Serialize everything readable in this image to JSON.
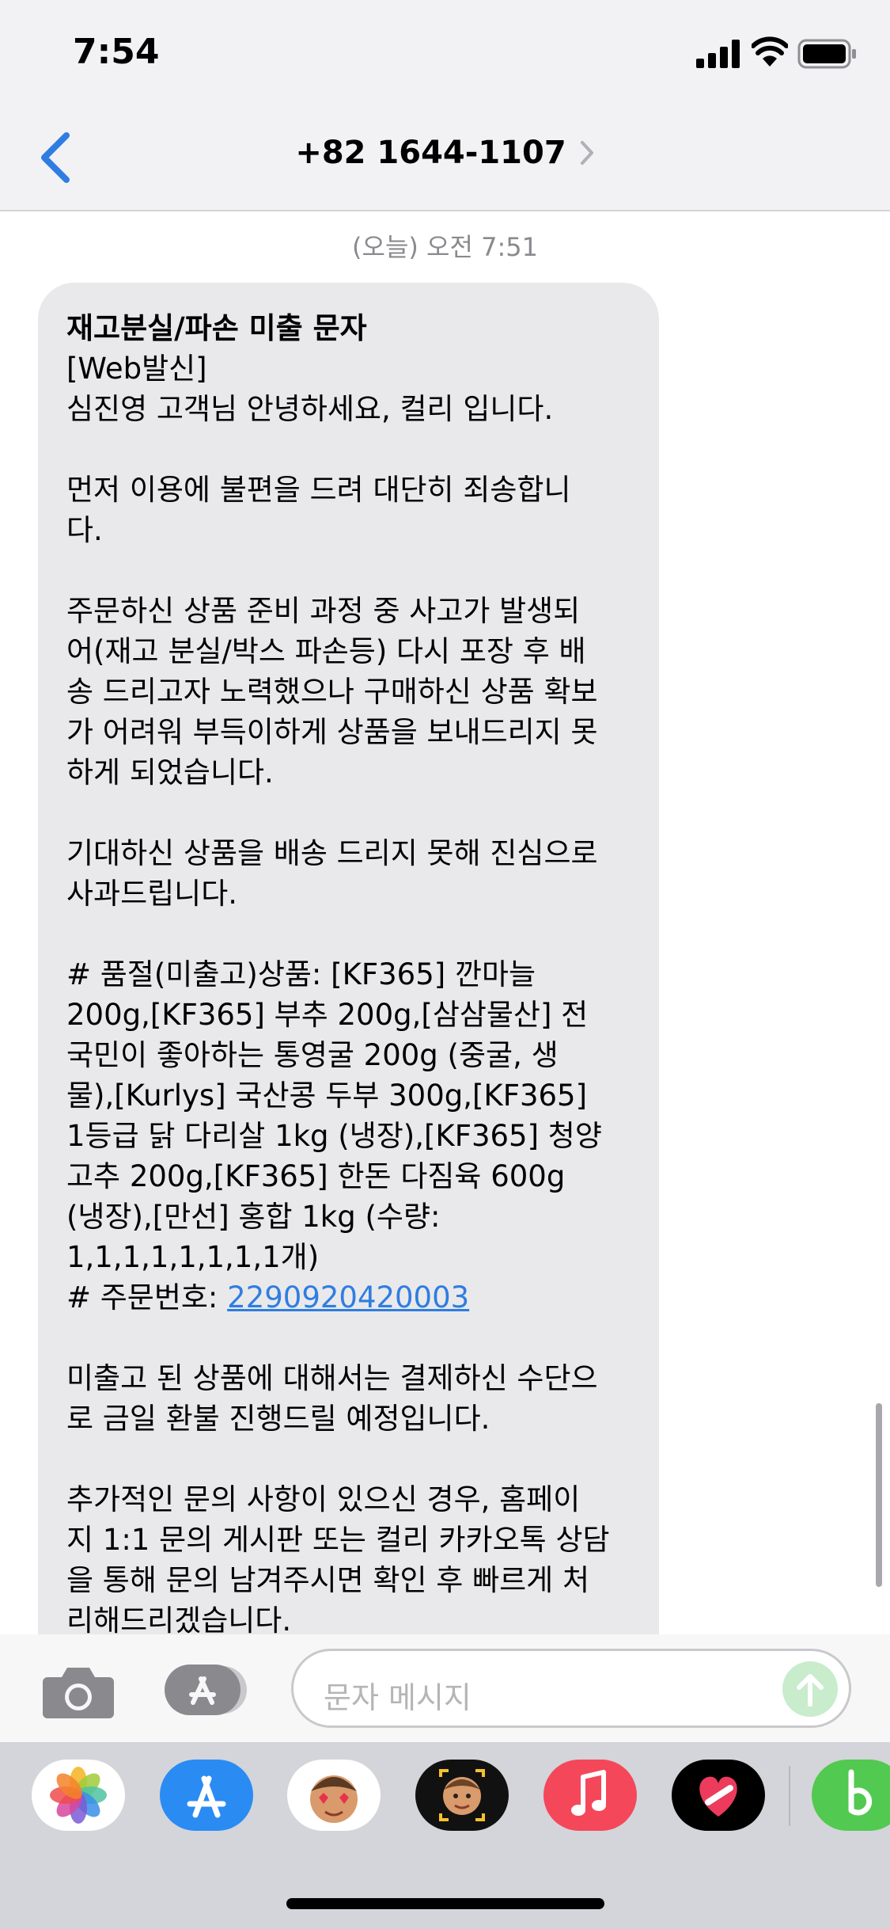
{
  "status_bar": {
    "time": "7:54"
  },
  "nav": {
    "title": "+82 1644-1107"
  },
  "thread": {
    "timestamp": "(오늘) 오전 7:51",
    "message_lines": [
      "재고분실/파손 미출 문자",
      "[Web발신]",
      "심진영 고객님 안녕하세요, 컬리 입니다.",
      "",
      "먼저 이용에 불편을 드려 대단히 죄송합니",
      "다.",
      "",
      "주문하신 상품 준비 과정 중 사고가 발생되",
      "어(재고 분실/박스 파손등) 다시 포장 후 배",
      "송 드리고자 노력했으나 구매하신 상품 확보",
      "가 어려워 부득이하게 상품을 보내드리지 못",
      "하게 되었습니다.",
      "",
      "기대하신 상품을 배송 드리지 못해 진심으로",
      "사과드립니다.",
      "",
      "# 품절(미출고)상품: [KF365] 깐마늘",
      "200g,[KF365] 부추 200g,[삼삼물산] 전",
      "국민이 좋아하는 통영굴 200g (중굴, 생",
      "물),[Kurlys] 국산콩 두부 300g,[KF365]",
      "1등급 닭 다리살 1kg (냉장),[KF365] 청양",
      "고추 200g,[KF365] 한돈 다짐육 600g",
      "(냉장),[만선] 홍합 1kg (수량:",
      "1,1,1,1,1,1,1,1개)"
    ],
    "order_prefix": "# 주문번호: ",
    "order_number": "2290920420003",
    "message_lines_after": [
      "",
      "미출고 된 상품에 대해서는 결제하신 수단으",
      "로 금일 환불 진행드릴 예정입니다.",
      "",
      "추가적인 문의 사항이 있으신 경우, 홈페이",
      "지 1:1 문의 게시판 또는 컬리 카카오톡 상담",
      "을 통해 문의 남겨주시면 확인 후 빠르게 처",
      "리해드리겠습니다."
    ]
  },
  "input": {
    "placeholder": "문자 메시지"
  },
  "app_drawer": {
    "apps": [
      "photos-icon",
      "appstore-icon",
      "memoji-icon",
      "memoji-camera-icon",
      "music-icon",
      "heart-app-icon",
      "green-b-app-icon"
    ]
  },
  "colors": {
    "bubble": "#e9e9eb",
    "link": "#2f7de1",
    "accent": "#2f7de1",
    "send_disabled": "#c8eccc"
  }
}
